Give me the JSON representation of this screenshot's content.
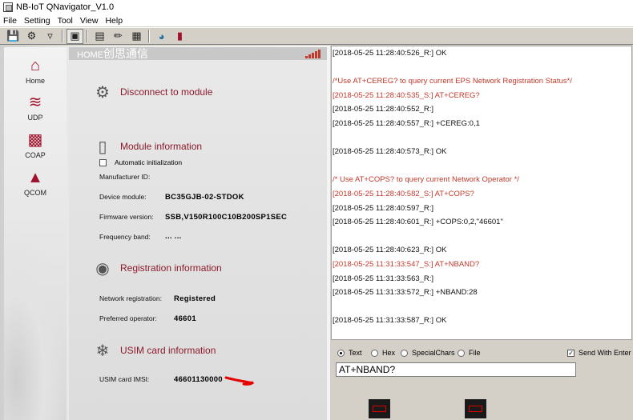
{
  "window": {
    "title": "NB-IoT QNavigator_V1.0"
  },
  "menu": [
    "File",
    "Setting",
    "Tool",
    "View",
    "Help"
  ],
  "toolbar": {
    "icons": [
      "save-icon",
      "settings-icon",
      "filter-icon",
      "terminal-icon",
      "floppy-icon",
      "highlighter-icon",
      "document-icon",
      "globe-icon",
      "book-icon"
    ]
  },
  "nav": {
    "items": [
      {
        "label": "Home",
        "icon": "home-icon"
      },
      {
        "label": "UDP",
        "icon": "wifi-icon"
      },
      {
        "label": "COAP",
        "icon": "chat-icon"
      },
      {
        "label": "QCOM",
        "icon": "upload-icon"
      }
    ]
  },
  "panel": {
    "header": "HOME",
    "header_cn": "创思通信",
    "disconnect_title": "Disconnect to module",
    "auto_init": "Automatic initialization",
    "module_title": "Module information",
    "manufacturer_label": "Manufacturer ID:",
    "manufacturer_value": "",
    "device_label": "Device module:",
    "device_value": "BC35GJB-02-STDOK",
    "firmware_label": "Firmware version:",
    "firmware_value": "SSB,V150R100C10B200SP1SEC",
    "band_label": "Frequency band:",
    "band_value": "... ...",
    "reg_title": "Registration information",
    "netreg_label": "Network registration:",
    "netreg_value": "Registered",
    "operator_label": "Preferred operator:",
    "operator_value": "46601",
    "usim_title": "USIM card information",
    "imsi_label": "USIM card IMSI:",
    "imsi_value": "46601130000"
  },
  "log": [
    {
      "t": "[2018-05-25 11:28:40:526_R:] OK",
      "k": "r"
    },
    {
      "t": "",
      "k": "r"
    },
    {
      "t": "/*Use AT+CEREG? to query current EPS Network Registration Status*/",
      "k": "c"
    },
    {
      "t": "[2018-05-25 11:28:40:535_S:] AT+CEREG?",
      "k": "s"
    },
    {
      "t": "[2018-05-25 11:28:40:552_R:]",
      "k": "r"
    },
    {
      "t": "[2018-05-25 11:28:40:557_R:] +CEREG:0,1",
      "k": "r"
    },
    {
      "t": "",
      "k": "r"
    },
    {
      "t": "[2018-05-25 11:28:40:573_R:] OK",
      "k": "r"
    },
    {
      "t": "",
      "k": "r"
    },
    {
      "t": "/* Use AT+COPS? to query current Network Operator */",
      "k": "c"
    },
    {
      "t": "[2018-05-25 11:28:40:582_S:] AT+COPS?",
      "k": "s"
    },
    {
      "t": "[2018-05-25 11:28:40:597_R:]",
      "k": "r"
    },
    {
      "t": "[2018-05-25 11:28:40:601_R:] +COPS:0,2,\"46601\"",
      "k": "r"
    },
    {
      "t": "",
      "k": "r"
    },
    {
      "t": "[2018-05-25 11:28:40:623_R:] OK",
      "k": "r"
    },
    {
      "t": "[2018-05-25 11:31:33:547_S:] AT+NBAND?",
      "k": "s"
    },
    {
      "t": "[2018-05-25 11:31:33:563_R:]",
      "k": "r"
    },
    {
      "t": "[2018-05-25 11:31:33:572_R:] +NBAND:28",
      "k": "r"
    },
    {
      "t": "",
      "k": "r"
    },
    {
      "t": "[2018-05-25 11:31:33:587_R:] OK",
      "k": "r"
    }
  ],
  "send": {
    "modes": [
      "Text",
      "Hex",
      "SpecialChars",
      "File"
    ],
    "selected": "Text",
    "send_with_enter": "Send With Enter",
    "input_value": "AT+NBAND?"
  },
  "colors": {
    "accent": "#8b1a2b",
    "send": "#c0392b"
  }
}
